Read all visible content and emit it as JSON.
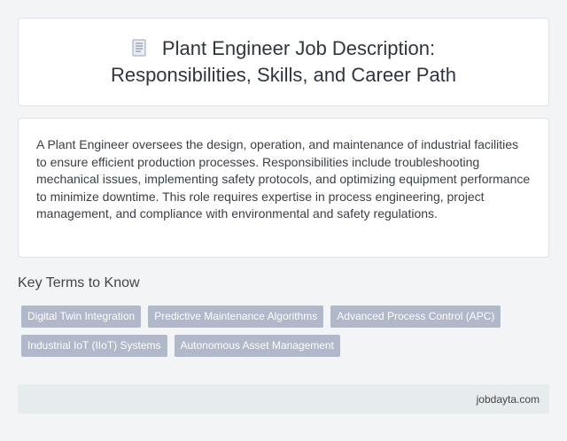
{
  "header": {
    "icon": "document-icon",
    "title_line1": "Plant Engineer Job Description:",
    "title_line2": "Responsibilities, Skills, and Career Path"
  },
  "description": {
    "text": "A Plant Engineer oversees the design, operation, and maintenance of industrial facilities to ensure efficient production processes. Responsibilities include troubleshooting mechanical issues, implementing safety protocols, and optimizing equipment performance to minimize downtime. This role requires expertise in process engineering, project management, and compliance with environmental and safety regulations."
  },
  "key_terms": {
    "heading": "Key Terms to Know",
    "tags": [
      "Digital Twin Integration",
      "Predictive Maintenance Algorithms",
      "Advanced Process Control (APC)",
      "Industrial IoT (IIoT) Systems",
      "Autonomous Asset Management"
    ]
  },
  "footer": {
    "site": "jobdayta.com"
  },
  "colors": {
    "tag_bg": "#b0b8c9",
    "footer_bg": "#e6ebee",
    "page_bg": "#f2f4f6"
  }
}
